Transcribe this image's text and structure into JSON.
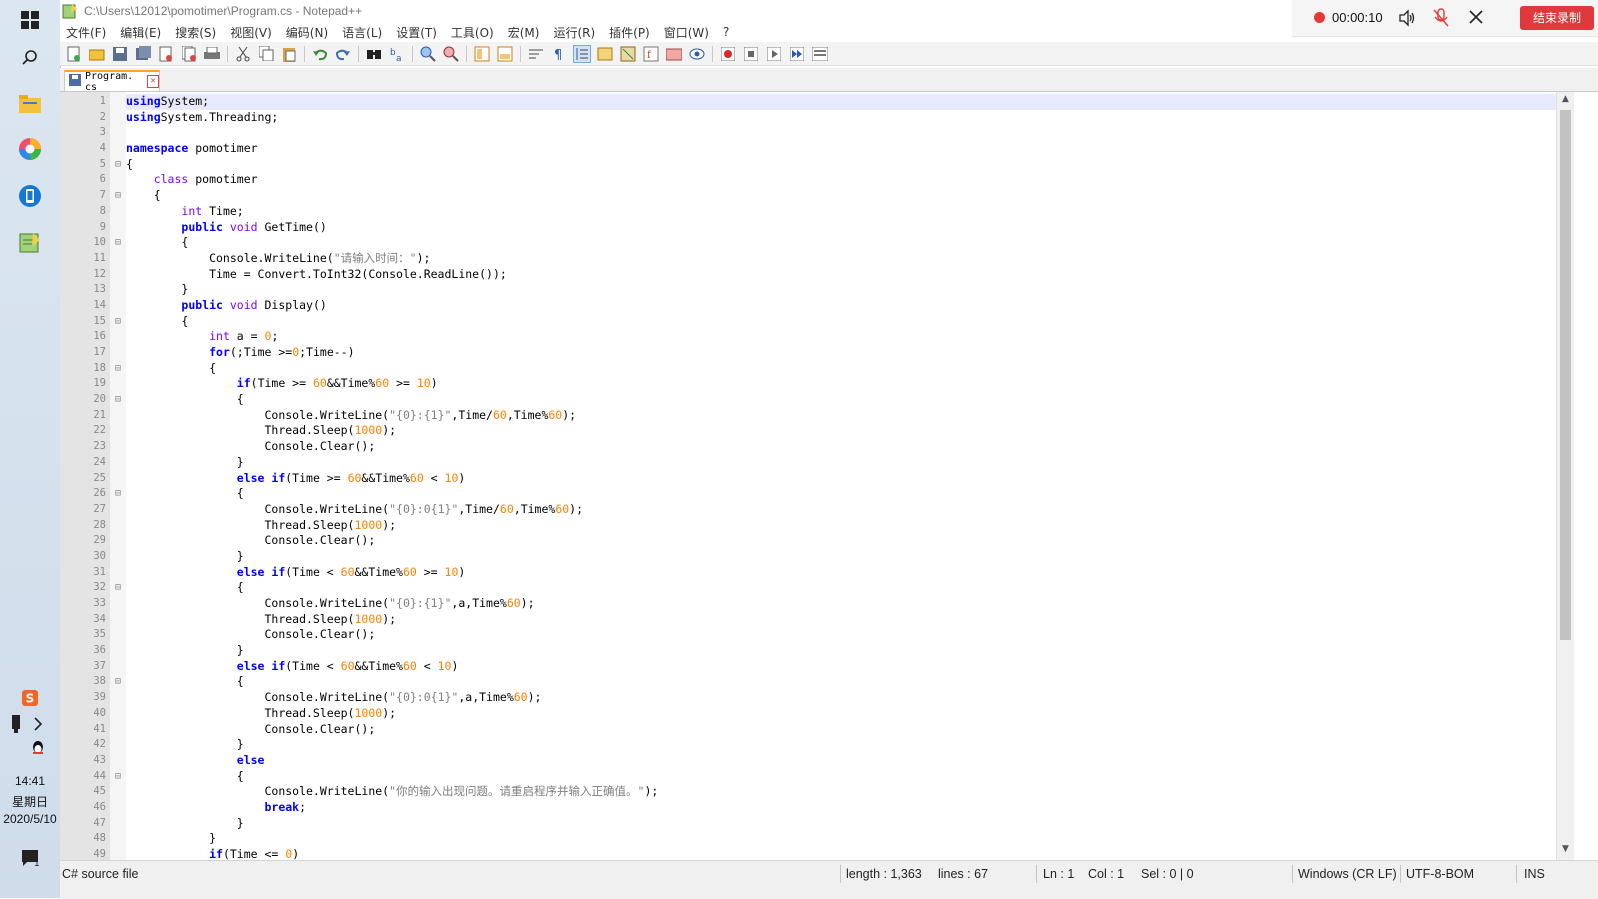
{
  "window": {
    "title": "C:\\Users\\12012\\pomotimer\\Program.cs - Notepad++"
  },
  "recorder": {
    "time": "00:00:10",
    "end_label": "结束录制"
  },
  "menu": [
    "文件(F)",
    "编辑(E)",
    "搜索(S)",
    "视图(V)",
    "编码(N)",
    "语言(L)",
    "设置(T)",
    "工具(O)",
    "宏(M)",
    "运行(R)",
    "插件(P)",
    "窗口(W)",
    "?"
  ],
  "tab": {
    "label": "Program. cs"
  },
  "code": [
    {
      "n": "1",
      "fold": "",
      "t": [
        [
          "kw",
          "using"
        ],
        [
          "",
          "System;"
        ]
      ]
    },
    {
      "n": "2",
      "fold": "",
      "t": [
        [
          "kw",
          "using"
        ],
        [
          "",
          "System.Threading;"
        ]
      ]
    },
    {
      "n": "3",
      "fold": "",
      "t": []
    },
    {
      "n": "4",
      "fold": "",
      "t": [
        [
          "kw",
          "namespace"
        ],
        [
          "",
          " pomotimer"
        ]
      ]
    },
    {
      "n": "5",
      "fold": "⊟",
      "t": [
        [
          "",
          "{"
        ]
      ]
    },
    {
      "n": "6",
      "fold": "",
      "t": [
        [
          "",
          "    "
        ],
        [
          "kw2",
          "class"
        ],
        [
          "",
          " pomotimer"
        ]
      ]
    },
    {
      "n": "7",
      "fold": "⊟",
      "t": [
        [
          "",
          "    {"
        ]
      ]
    },
    {
      "n": "8",
      "fold": "",
      "t": [
        [
          "",
          "        "
        ],
        [
          "kw2",
          "int"
        ],
        [
          "",
          " Time;"
        ]
      ]
    },
    {
      "n": "9",
      "fold": "",
      "t": [
        [
          "",
          "        "
        ],
        [
          "kw",
          "public"
        ],
        [
          "",
          " "
        ],
        [
          "kw2",
          "void"
        ],
        [
          "",
          " GetTime()"
        ]
      ]
    },
    {
      "n": "10",
      "fold": "⊟",
      "t": [
        [
          "",
          "        {"
        ]
      ]
    },
    {
      "n": "11",
      "fold": "",
      "t": [
        [
          "",
          "            Console.WriteLine("
        ],
        [
          "str",
          "\"请输入时间：\""
        ],
        [
          "",
          ");"
        ]
      ]
    },
    {
      "n": "12",
      "fold": "",
      "t": [
        [
          "",
          "            Time = Convert.ToInt32(Console.ReadLine());"
        ]
      ]
    },
    {
      "n": "13",
      "fold": "",
      "t": [
        [
          "",
          "        }"
        ]
      ]
    },
    {
      "n": "14",
      "fold": "",
      "t": [
        [
          "",
          "        "
        ],
        [
          "kw",
          "public"
        ],
        [
          "",
          " "
        ],
        [
          "kw2",
          "void"
        ],
        [
          "",
          " Display()"
        ]
      ]
    },
    {
      "n": "15",
      "fold": "⊟",
      "t": [
        [
          "",
          "        {"
        ]
      ]
    },
    {
      "n": "16",
      "fold": "",
      "t": [
        [
          "",
          "            "
        ],
        [
          "kw2",
          "int"
        ],
        [
          "",
          " a = "
        ],
        [
          "num",
          "0"
        ],
        [
          "",
          ";"
        ]
      ]
    },
    {
      "n": "17",
      "fold": "",
      "t": [
        [
          "",
          "            "
        ],
        [
          "kw",
          "for"
        ],
        [
          "",
          "(;Time >="
        ],
        [
          "num",
          "0"
        ],
        [
          "",
          ";Time--)"
        ]
      ]
    },
    {
      "n": "18",
      "fold": "⊟",
      "t": [
        [
          "",
          "            {"
        ]
      ]
    },
    {
      "n": "19",
      "fold": "",
      "t": [
        [
          "",
          "                "
        ],
        [
          "kw",
          "if"
        ],
        [
          "",
          "(Time >= "
        ],
        [
          "num",
          "60"
        ],
        [
          "",
          "&&Time%"
        ],
        [
          "num",
          "60"
        ],
        [
          "",
          " >= "
        ],
        [
          "num",
          "10"
        ],
        [
          "",
          ")"
        ]
      ]
    },
    {
      "n": "20",
      "fold": "⊟",
      "t": [
        [
          "",
          "                {"
        ]
      ]
    },
    {
      "n": "21",
      "fold": "",
      "t": [
        [
          "",
          "                    Console.WriteLine("
        ],
        [
          "str",
          "\"{0}:{1}\""
        ],
        [
          "",
          ",Time/"
        ],
        [
          "num",
          "60"
        ],
        [
          "",
          ",Time%"
        ],
        [
          "num",
          "60"
        ],
        [
          "",
          ");"
        ]
      ]
    },
    {
      "n": "22",
      "fold": "",
      "t": [
        [
          "",
          "                    Thread.Sleep("
        ],
        [
          "num",
          "1000"
        ],
        [
          "",
          ");"
        ]
      ]
    },
    {
      "n": "23",
      "fold": "",
      "t": [
        [
          "",
          "                    Console.Clear();"
        ]
      ]
    },
    {
      "n": "24",
      "fold": "",
      "t": [
        [
          "",
          "                }"
        ]
      ]
    },
    {
      "n": "25",
      "fold": "",
      "t": [
        [
          "",
          "                "
        ],
        [
          "kw",
          "else if"
        ],
        [
          "",
          "(Time >= "
        ],
        [
          "num",
          "60"
        ],
        [
          "",
          "&&Time%"
        ],
        [
          "num",
          "60"
        ],
        [
          "",
          " < "
        ],
        [
          "num",
          "10"
        ],
        [
          "",
          ")"
        ]
      ]
    },
    {
      "n": "26",
      "fold": "⊟",
      "t": [
        [
          "",
          "                {"
        ]
      ]
    },
    {
      "n": "27",
      "fold": "",
      "t": [
        [
          "",
          "                    Console.WriteLine("
        ],
        [
          "str",
          "\"{0}:0{1}\""
        ],
        [
          "",
          ",Time/"
        ],
        [
          "num",
          "60"
        ],
        [
          "",
          ",Time%"
        ],
        [
          "num",
          "60"
        ],
        [
          "",
          ");"
        ]
      ]
    },
    {
      "n": "28",
      "fold": "",
      "t": [
        [
          "",
          "                    Thread.Sleep("
        ],
        [
          "num",
          "1000"
        ],
        [
          "",
          ");"
        ]
      ]
    },
    {
      "n": "29",
      "fold": "",
      "t": [
        [
          "",
          "                    Console.Clear();"
        ]
      ]
    },
    {
      "n": "30",
      "fold": "",
      "t": [
        [
          "",
          "                }"
        ]
      ]
    },
    {
      "n": "31",
      "fold": "",
      "t": [
        [
          "",
          "                "
        ],
        [
          "kw",
          "else if"
        ],
        [
          "",
          "(Time < "
        ],
        [
          "num",
          "60"
        ],
        [
          "",
          "&&Time%"
        ],
        [
          "num",
          "60"
        ],
        [
          "",
          " >= "
        ],
        [
          "num",
          "10"
        ],
        [
          "",
          ")"
        ]
      ]
    },
    {
      "n": "32",
      "fold": "⊟",
      "t": [
        [
          "",
          "                {"
        ]
      ]
    },
    {
      "n": "33",
      "fold": "",
      "t": [
        [
          "",
          "                    Console.WriteLine("
        ],
        [
          "str",
          "\"{0}:{1}\""
        ],
        [
          "",
          ",a,Time%"
        ],
        [
          "num",
          "60"
        ],
        [
          "",
          ");"
        ]
      ]
    },
    {
      "n": "34",
      "fold": "",
      "t": [
        [
          "",
          "                    Thread.Sleep("
        ],
        [
          "num",
          "1000"
        ],
        [
          "",
          ");"
        ]
      ]
    },
    {
      "n": "35",
      "fold": "",
      "t": [
        [
          "",
          "                    Console.Clear();"
        ]
      ]
    },
    {
      "n": "36",
      "fold": "",
      "t": [
        [
          "",
          "                }"
        ]
      ]
    },
    {
      "n": "37",
      "fold": "",
      "t": [
        [
          "",
          "                "
        ],
        [
          "kw",
          "else if"
        ],
        [
          "",
          "(Time < "
        ],
        [
          "num",
          "60"
        ],
        [
          "",
          "&&Time%"
        ],
        [
          "num",
          "60"
        ],
        [
          "",
          " < "
        ],
        [
          "num",
          "10"
        ],
        [
          "",
          ")"
        ]
      ]
    },
    {
      "n": "38",
      "fold": "⊟",
      "t": [
        [
          "",
          "                {"
        ]
      ]
    },
    {
      "n": "39",
      "fold": "",
      "t": [
        [
          "",
          "                    Console.WriteLine("
        ],
        [
          "str",
          "\"{0}:0{1}\""
        ],
        [
          "",
          ",a,Time%"
        ],
        [
          "num",
          "60"
        ],
        [
          "",
          ");"
        ]
      ]
    },
    {
      "n": "40",
      "fold": "",
      "t": [
        [
          "",
          "                    Thread.Sleep("
        ],
        [
          "num",
          "1000"
        ],
        [
          "",
          ");"
        ]
      ]
    },
    {
      "n": "41",
      "fold": "",
      "t": [
        [
          "",
          "                    Console.Clear();"
        ]
      ]
    },
    {
      "n": "42",
      "fold": "",
      "t": [
        [
          "",
          "                }"
        ]
      ]
    },
    {
      "n": "43",
      "fold": "",
      "t": [
        [
          "",
          "                "
        ],
        [
          "kw",
          "else"
        ]
      ]
    },
    {
      "n": "44",
      "fold": "⊟",
      "t": [
        [
          "",
          "                {"
        ]
      ]
    },
    {
      "n": "45",
      "fold": "",
      "t": [
        [
          "",
          "                    Console.WriteLine("
        ],
        [
          "str",
          "\"你的输入出现问题。请重启程序并输入正确值。\""
        ],
        [
          "",
          ");"
        ]
      ]
    },
    {
      "n": "46",
      "fold": "",
      "t": [
        [
          "",
          "                    "
        ],
        [
          "kw",
          "break"
        ],
        [
          "",
          ";"
        ]
      ]
    },
    {
      "n": "47",
      "fold": "",
      "t": [
        [
          "",
          "                }"
        ]
      ]
    },
    {
      "n": "48",
      "fold": "",
      "t": [
        [
          "",
          "            }"
        ]
      ]
    },
    {
      "n": "49",
      "fold": "",
      "t": [
        [
          "",
          "            "
        ],
        [
          "kw",
          "if"
        ],
        [
          "",
          "(Time <= "
        ],
        [
          "num",
          "0"
        ],
        [
          "",
          ")"
        ]
      ]
    }
  ],
  "status": {
    "filetype": "C# source file",
    "length": "length : 1,363",
    "lines": "lines : 67",
    "ln": "Ln : 1",
    "col": "Col : 1",
    "sel": "Sel : 0 | 0",
    "eol": "Windows (CR LF)",
    "encoding": "UTF-8-BOM",
    "mode": "INS"
  },
  "taskbar": {
    "time": "14:41",
    "weekday": "星期日",
    "date": "2020/5/10"
  },
  "colors": {
    "keyword": "#0000ff",
    "type": "#8000ff",
    "number": "#ff8000",
    "string": "#808080",
    "record": "#e1393b"
  }
}
